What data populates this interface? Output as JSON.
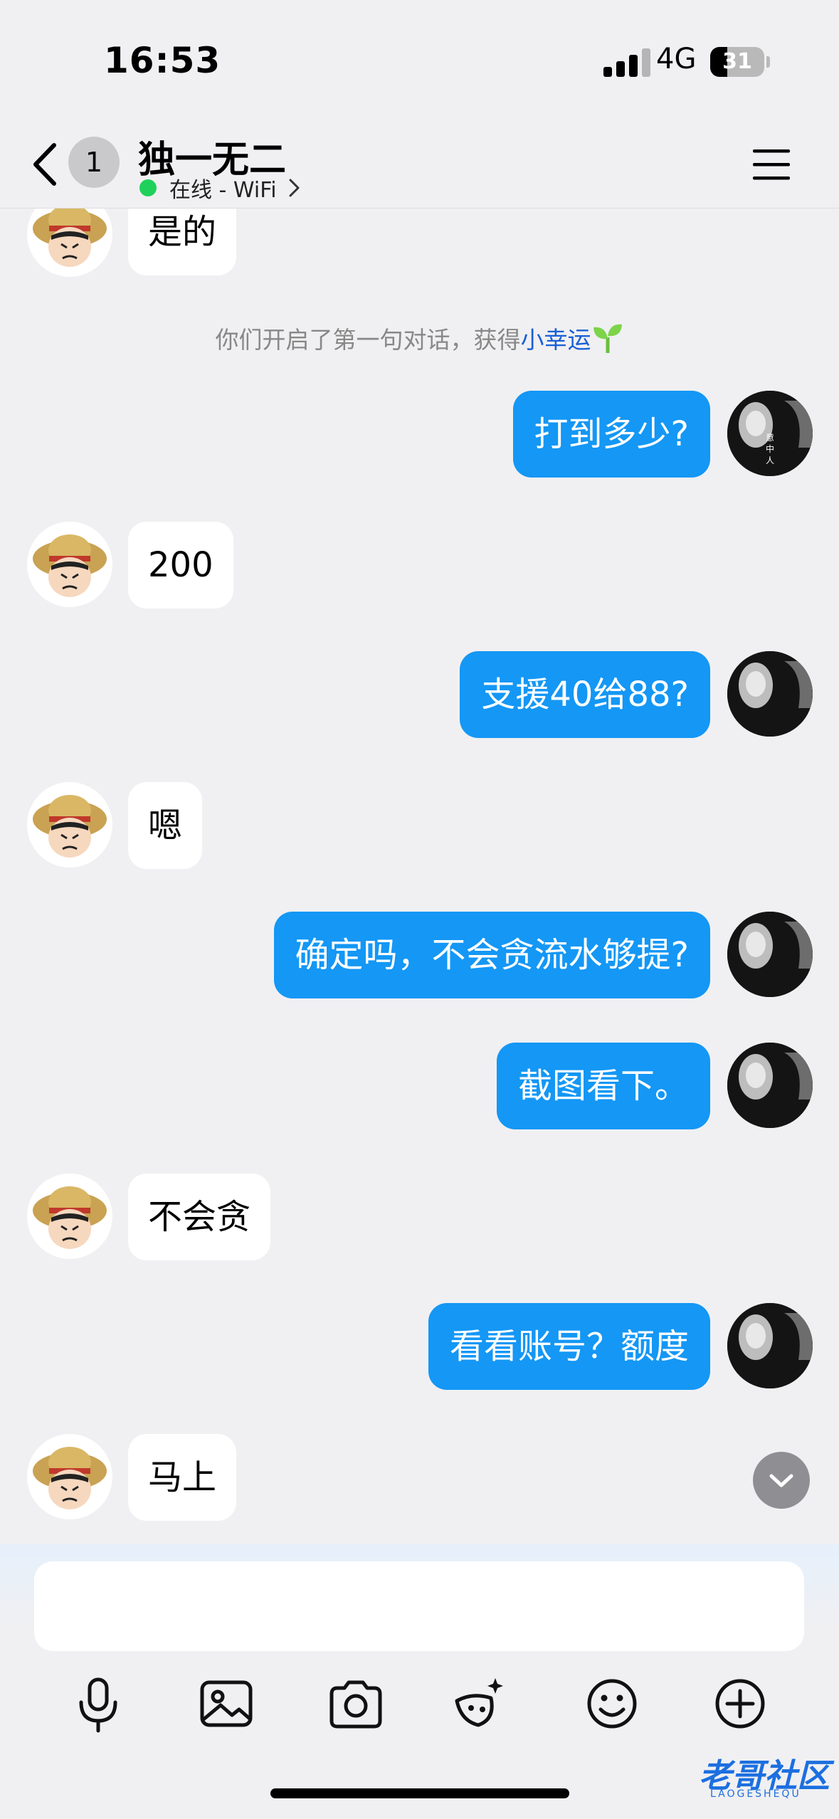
{
  "status_bar": {
    "time": "16:53",
    "network": "4G",
    "battery": "31"
  },
  "header": {
    "unread_count": "1",
    "title": "独一无二",
    "presence": "在线 - WiFi"
  },
  "system_message": {
    "text": "你们开启了第一句对话，获得",
    "link": "小幸运"
  },
  "messages": [
    {
      "side": "in",
      "text": "是的"
    },
    {
      "side": "out",
      "text": "打到多少?"
    },
    {
      "side": "in",
      "text": "200"
    },
    {
      "side": "out",
      "text": "支援40给88?"
    },
    {
      "side": "in",
      "text": "嗯"
    },
    {
      "side": "out",
      "text": "确定吗，不会贪流水够提?"
    },
    {
      "side": "out",
      "text": "截图看下。"
    },
    {
      "side": "in",
      "text": "不会贪"
    },
    {
      "side": "out",
      "text": "看看账号？额度"
    },
    {
      "side": "in",
      "text": "马上"
    }
  ],
  "composer": {
    "value": "",
    "placeholder": ""
  },
  "toolbar": [
    "microphone-icon",
    "image-icon",
    "camera-icon",
    "sticker-icon",
    "emoji-icon",
    "plus-icon"
  ],
  "avatar_right_caption": "意中人",
  "watermark": {
    "text": "老哥社区",
    "sub": "LAOGESHEQU"
  },
  "colors": {
    "outgoing_bubble": "#1497f5",
    "incoming_bubble": "#ffffff",
    "online_dot": "#1fd15b",
    "link": "#1a5fd6"
  }
}
